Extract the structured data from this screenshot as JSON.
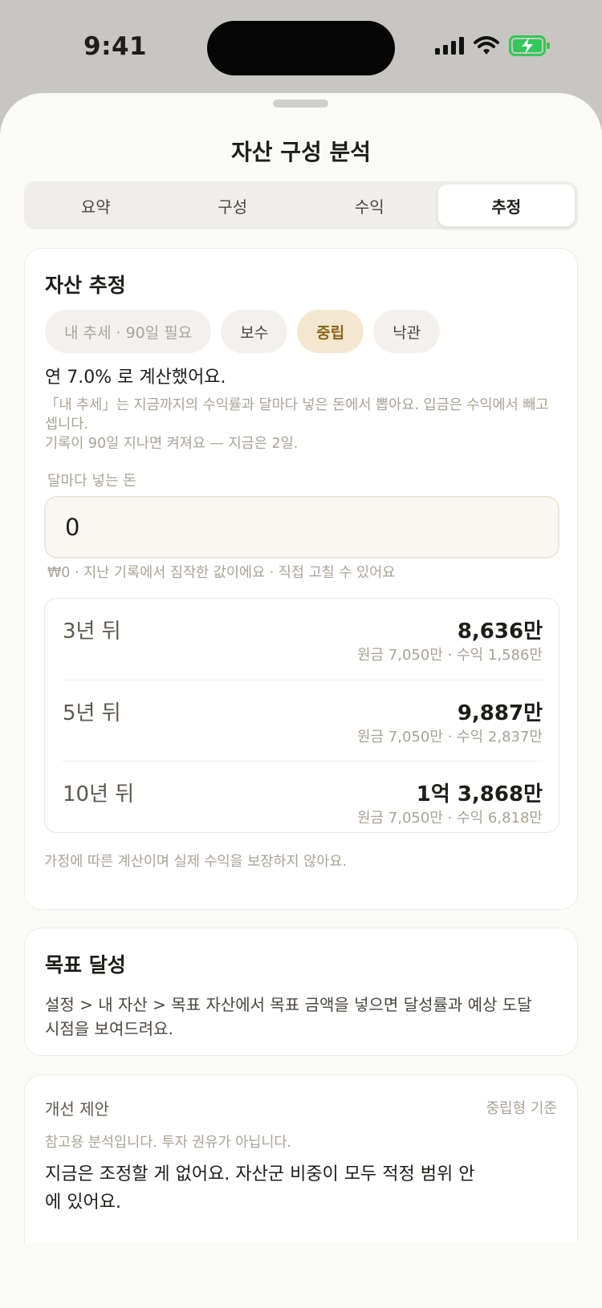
{
  "status_bar": {
    "time": "9:41"
  },
  "sheet": {
    "title": "자산 구성 분석"
  },
  "tabs": [
    {
      "label": "요약",
      "active": false
    },
    {
      "label": "구성",
      "active": false
    },
    {
      "label": "수익",
      "active": false
    },
    {
      "label": "추정",
      "active": true
    }
  ],
  "estimate": {
    "title": "자산 추정",
    "scenarios": [
      {
        "label": "내 추세 · 90일 필요",
        "state": "disabled"
      },
      {
        "label": "보수",
        "state": "normal"
      },
      {
        "label": "중립",
        "state": "selected"
      },
      {
        "label": "낙관",
        "state": "normal"
      }
    ],
    "rate_text": "연 7.0% 로 계산했어요.",
    "explanation": "「내 추세」는 지금까지의 수익률과 달마다 넣은 돈에서 뽑아요. 입금은 수익에서 빼고 셉니다.",
    "unlock_note": "기록이 90일 지나면 켜져요 — 지금은 2일.",
    "monthly_label": "달마다 넣는 돈",
    "monthly_value": "0",
    "monthly_hint": "₩0 · 지난 기록에서 짐작한 값이에요 · 직접 고칠 수 있어요",
    "projections": [
      {
        "period": "3년 뒤",
        "total": "8,636만",
        "detail": "원금 7,050만 · 수익 1,586만"
      },
      {
        "period": "5년 뒤",
        "total": "9,887만",
        "detail": "원금 7,050만 · 수익 2,837만"
      },
      {
        "period": "10년 뒤",
        "total": "1억 3,868만",
        "detail": "원금 7,050만 · 수익 6,818만"
      }
    ],
    "disclaimer": "가정에 따른 계산이며 실제 수익을 보장하지 않아요."
  },
  "goal": {
    "title": "목표 달성",
    "description": "설정 > 내 자산 > 목표 자산에서 목표 금액을 넣으면 달성률과 예상 도달 시점을 보여드려요."
  },
  "suggestion": {
    "title": "개선 제안",
    "basis": "중립형 기준",
    "note": "참고용 분석입니다. 투자 권유가 아닙니다.",
    "body": "지금은 조정할 게 없어요. 자산군 비중이 모두 적정 범위 안에 있어요."
  }
}
